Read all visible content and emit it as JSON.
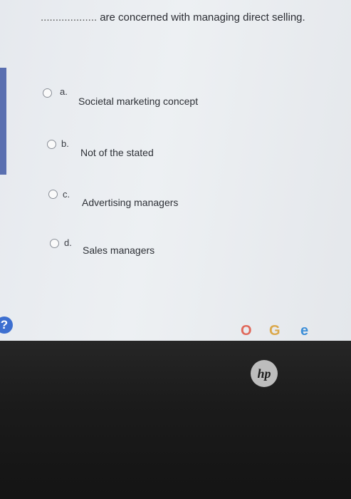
{
  "question": {
    "blank": "...................",
    "text": "are concerned with managing direct selling."
  },
  "options": [
    {
      "letter": "a.",
      "text": "Societal marketing concept"
    },
    {
      "letter": "b.",
      "text": "Not of the stated"
    },
    {
      "letter": "c.",
      "text": "Advertising managers"
    },
    {
      "letter": "d.",
      "text": "Sales managers"
    }
  ],
  "help_icon": {
    "glyph": "?",
    "icon": "help-icon"
  },
  "taskbar": {
    "icons": [
      {
        "name": "opera-icon",
        "glyph": "O",
        "color": "#e0685a"
      },
      {
        "name": "chrome-icon",
        "glyph": "G",
        "color": "#dba84b"
      },
      {
        "name": "edge-icon",
        "glyph": "e",
        "color": "#3d8fd8"
      }
    ]
  },
  "bezel": {
    "logo_text": "hp"
  },
  "colors": {
    "accent": "#5a6fb0",
    "help": "#3d6fd0"
  }
}
